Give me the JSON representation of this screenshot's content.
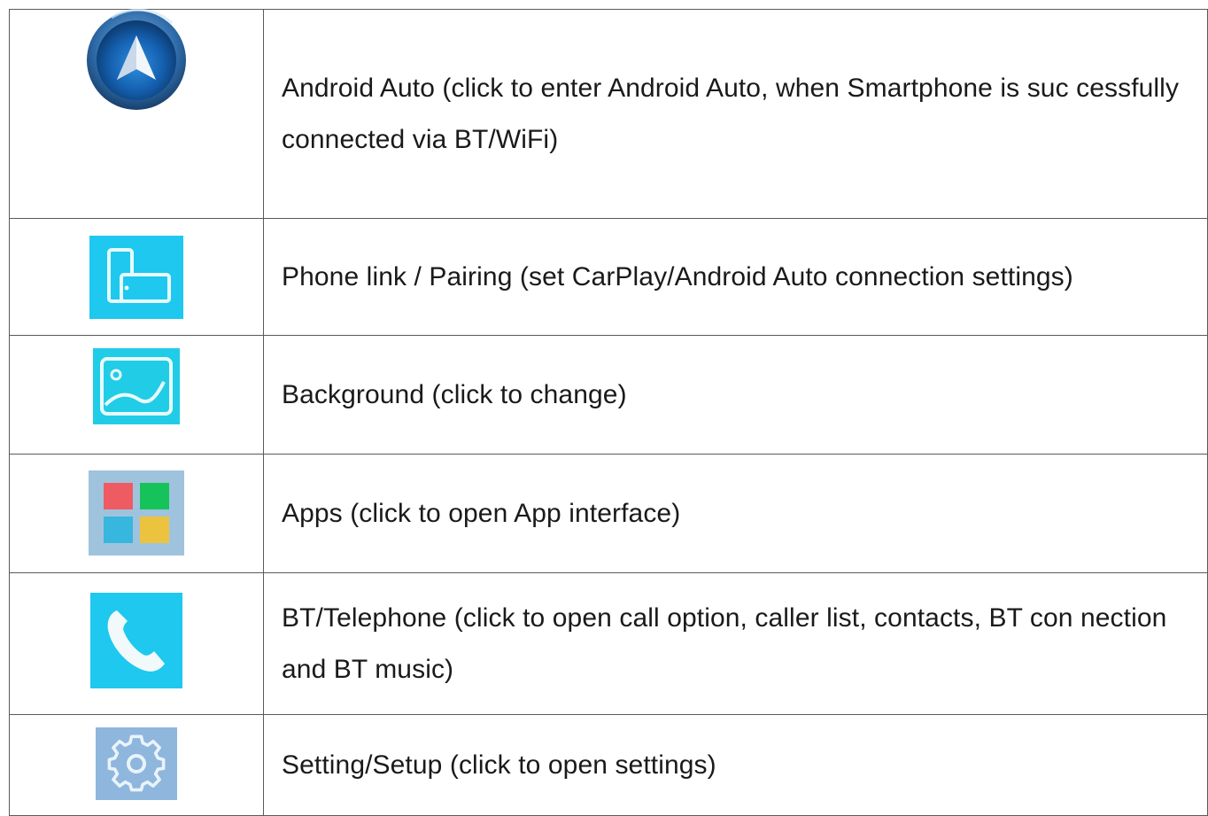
{
  "rows": [
    {
      "icon": "android-auto-icon",
      "text": "Android Auto (click to enter Android Auto, when Smartphone is suc cessfully connected via BT/WiFi)"
    },
    {
      "icon": "phone-link-icon",
      "text": "Phone link / Pairing (set CarPlay/Android Auto connection settings)"
    },
    {
      "icon": "background-image-icon",
      "text": "Background (click to change)"
    },
    {
      "icon": "apps-grid-icon",
      "text": "Apps (click to open App interface)"
    },
    {
      "icon": "telephone-icon",
      "text": "BT/Telephone (click to open call option, caller list, contacts, BT con nection and BT music)"
    },
    {
      "icon": "settings-gear-icon",
      "text": "Setting/Setup (click to open settings)"
    }
  ],
  "colors": {
    "border": "#5a5a5a",
    "cyan_tile": "#1ec8ee",
    "apps_tile": "#9fc3dd",
    "settings_tile": "#8fb6dc",
    "apps_red": "#ee5b63",
    "apps_green": "#16c35b",
    "apps_blue": "#37b6de",
    "apps_yellow": "#ecc33e"
  }
}
